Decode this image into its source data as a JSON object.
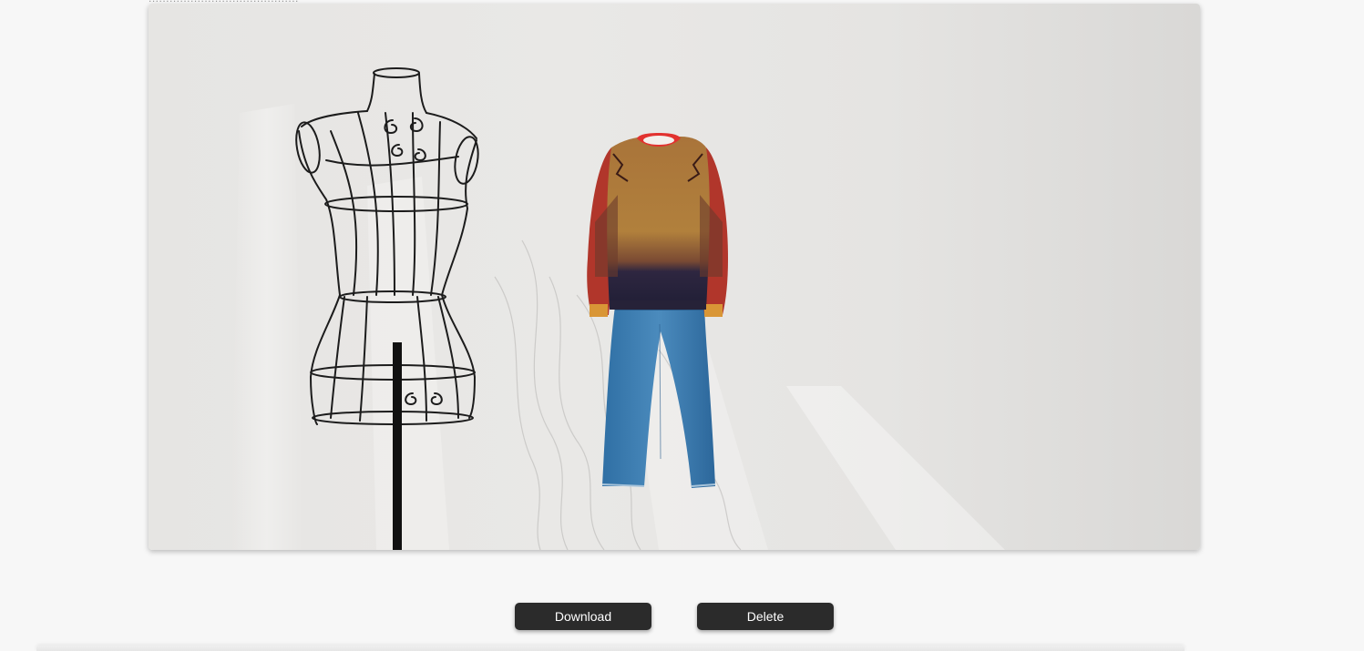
{
  "header": {
    "cut_text": "..........................................."
  },
  "canvas": {
    "scene": "mannequin-and-outfit"
  },
  "actions": {
    "download_label": "Download",
    "delete_label": "Delete"
  }
}
